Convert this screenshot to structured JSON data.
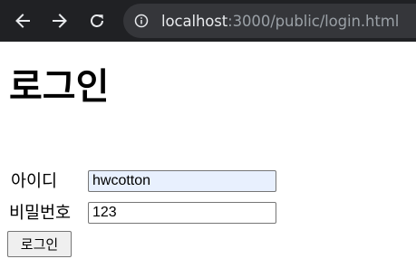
{
  "browser": {
    "url_host": "localhost",
    "url_path": ":3000/public/login.html"
  },
  "page": {
    "title": "로그인",
    "id_label": "아이디",
    "id_value": "hwcotton",
    "password_label": "비밀번호",
    "password_value": "123",
    "submit_label": "로그인"
  }
}
